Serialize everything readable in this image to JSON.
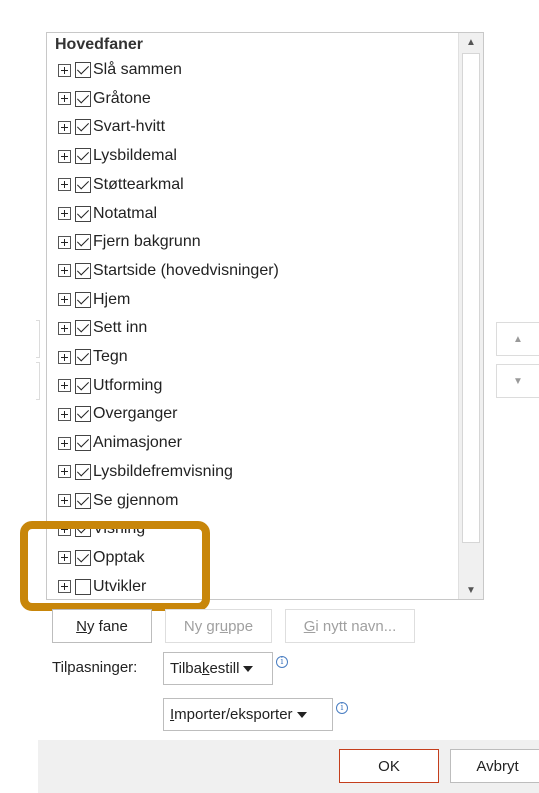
{
  "tree": {
    "header": "Hovedfaner",
    "items": [
      {
        "label": "Slå sammen",
        "checked": true
      },
      {
        "label": "Gråtone",
        "checked": true
      },
      {
        "label": "Svart-hvitt",
        "checked": true
      },
      {
        "label": "Lysbildemal",
        "checked": true
      },
      {
        "label": "Støttearkmal",
        "checked": true
      },
      {
        "label": "Notatmal",
        "checked": true
      },
      {
        "label": "Fjern bakgrunn",
        "checked": true
      },
      {
        "label": "Startside (hovedvisninger)",
        "checked": true
      },
      {
        "label": "Hjem",
        "checked": true
      },
      {
        "label": "Sett inn",
        "checked": true
      },
      {
        "label": "Tegn",
        "checked": true
      },
      {
        "label": "Utforming",
        "checked": true
      },
      {
        "label": "Overganger",
        "checked": true
      },
      {
        "label": "Animasjoner",
        "checked": true
      },
      {
        "label": "Lysbildefremvisning",
        "checked": true
      },
      {
        "label": "Se gjennom",
        "checked": true
      },
      {
        "label": "Visning",
        "checked": true
      },
      {
        "label": "Opptak",
        "checked": true
      },
      {
        "label": "Utvikler",
        "checked": false
      }
    ]
  },
  "buttons": {
    "new_tab": {
      "pre": "",
      "u": "N",
      "post": "y fane"
    },
    "new_group": {
      "pre": "Ny gr",
      "u": "u",
      "post": "ppe"
    },
    "rename": {
      "pre": "",
      "u": "G",
      "post": "i nytt navn..."
    }
  },
  "customizations": {
    "label": "Tilpasninger:",
    "reset": {
      "pre": "Tilba",
      "u": "k",
      "post": "estill"
    },
    "import_export": {
      "pre": "",
      "u": "I",
      "post": "mporter/eksporter"
    },
    "info_glyph": "i"
  },
  "footer": {
    "ok": "OK",
    "cancel": "Avbryt"
  },
  "colors": {
    "highlight": "#c8860a",
    "ok_border": "#c43e1c",
    "info": "#4a7ec2"
  }
}
